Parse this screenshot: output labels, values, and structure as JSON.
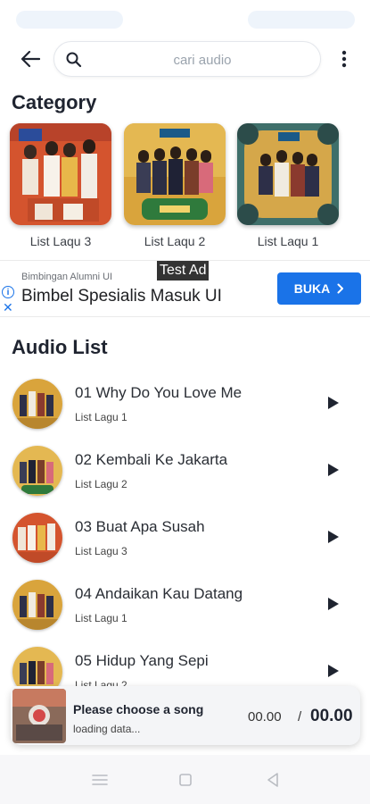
{
  "search": {
    "placeholder": "cari audio"
  },
  "categories_section": {
    "title": "Category",
    "items": [
      {
        "label": "List Laqu 3"
      },
      {
        "label": "List Laqu 2"
      },
      {
        "label": "List Laqu 1"
      }
    ]
  },
  "ad": {
    "tag": "Test Ad",
    "advertiser": "Bimbingan Alumni UI",
    "headline": "Bimbel Spesialis Masuk UI",
    "cta": "BUKA"
  },
  "audio_section": {
    "title": "Audio List",
    "songs": [
      {
        "title": "01 Why Do You Love Me",
        "list": "List Lagu 1"
      },
      {
        "title": "02 Kembali Ke Jakarta",
        "list": "List Lagu 2"
      },
      {
        "title": "03 Buat Apa Susah",
        "list": "List Lagu 3"
      },
      {
        "title": "04 Andaikan Kau Datang",
        "list": "List Lagu 1"
      },
      {
        "title": "05 Hidup Yang Sepi",
        "list": "List Lagu 2"
      }
    ]
  },
  "player": {
    "title": "Please choose a song",
    "status": "loading data...",
    "current_time": "00.00",
    "separator": "/",
    "total_time": "00.00"
  },
  "colors": {
    "accent": "#1a73e8",
    "text": "#1f2430"
  },
  "icons": [
    "back-arrow-icon",
    "search-icon",
    "more-vert-icon",
    "play-icon",
    "info-icon",
    "close-icon",
    "chevron-right-icon",
    "menu-icon",
    "home-square-icon",
    "back-triangle-icon"
  ]
}
